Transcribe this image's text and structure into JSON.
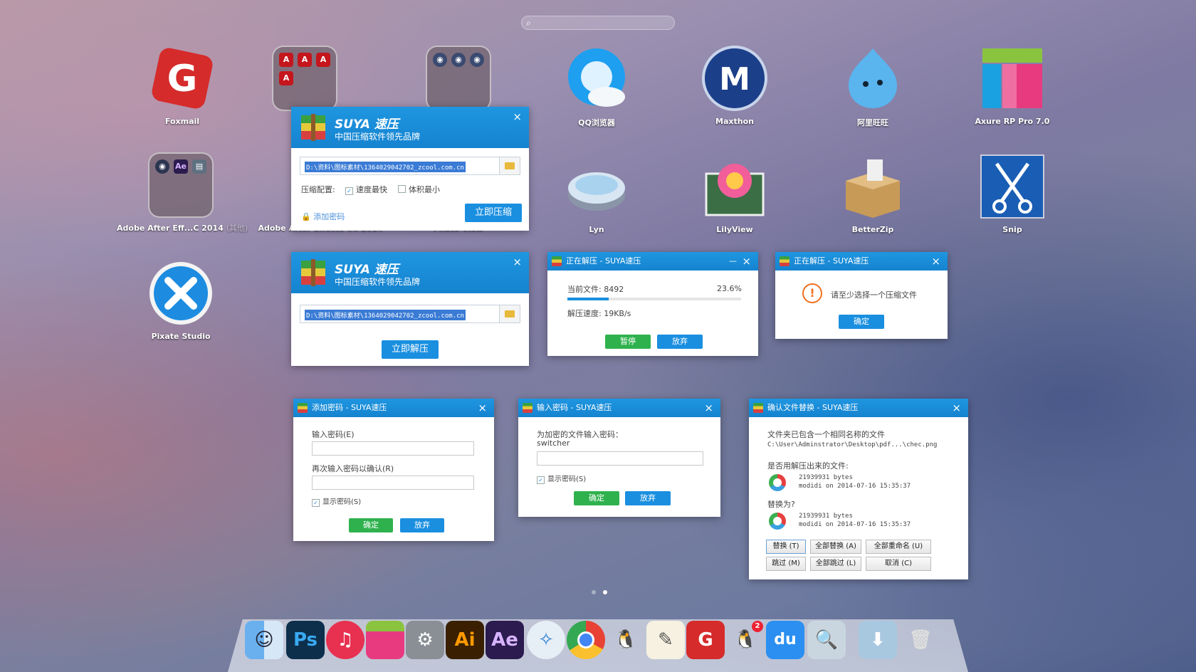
{
  "search": {
    "glyph": "⌕"
  },
  "apps": {
    "foxmail": "Foxmail",
    "folder_adobe": "",
    "folder_photo": "",
    "qq": "QQ浏览器",
    "maxthon": "Maxthon",
    "aliww": "阿里旺旺",
    "axure": "Axure RP Pro 7.0",
    "after_eff": "Adobe After Eff...C 2014",
    "after_eff_suffix": "(其他)",
    "after_effects_cc": "Adobe After Effects CC 2014",
    "photo_view": "Photo View",
    "lyn": "Lyn",
    "lilyview": "LilyView",
    "betterzip": "BetterZip",
    "snip": "Snip",
    "pixate": "Pixate Studio"
  },
  "win_compress": {
    "brand": "SUYA 速压",
    "slogan": "中国压缩软件领先品牌",
    "path": "D:\\资料\\图标素材\\1364029042702_zcool.com.cn",
    "config_label": "压缩配置:",
    "opt_fast": "速度最快",
    "opt_small": "体积最小",
    "add_password": "添加密码",
    "button": "立即压缩"
  },
  "win_extract": {
    "brand": "SUYA 速压",
    "slogan": "中国压缩软件领先品牌",
    "path": "D:\\资料\\图标素材\\1364029042702_zcool.com.cn",
    "button": "立即解压"
  },
  "win_progress": {
    "title": "正在解压 - SUYA速压",
    "current_file": "当前文件: 8492",
    "percent": "23.6%",
    "progress": 0.236,
    "speed": "解压速度: 19KB/s",
    "pause": "暂停",
    "cancel": "放弃"
  },
  "win_alert": {
    "title": "正在解压 - SUYA速压",
    "message": "请至少选择一个压缩文件",
    "ok": "确定"
  },
  "win_addpwd": {
    "title": "添加密码 - SUYA速压",
    "label_enter": "输入密码(E)",
    "label_confirm": "再次输入密码以确认(R)",
    "show": "显示密码(S)",
    "ok": "确定",
    "cancel": "放弃"
  },
  "win_enterpwd": {
    "title": "输入密码 - SUYA速压",
    "prompt": "为加密的文件输入密码：",
    "filename": "switcher",
    "show": "显示密码(S)",
    "ok": "确定",
    "cancel": "放弃"
  },
  "win_replace": {
    "title": "确认文件替换 - SUYA速压",
    "line1": "文件夹已包含一个相同名称的文件",
    "path": "C:\\User\\Adminstrator\\Desktop\\pdf...\\chec.png",
    "question1": "是否用解压出来的文件:",
    "size1": "21939931 bytes",
    "mod1": "modidi on 2014-07-16 15:35:37",
    "question2": "替换为?",
    "size2": "21939931 bytes",
    "mod2": "modidi on 2014-07-16 15:35:37",
    "replace": "替换 (T)",
    "replace_all": "全部替换 (A)",
    "rename_all": "全部重命名 (U)",
    "skip": "跳过 (M)",
    "skip_all": "全部跳过 (L)",
    "cancel": "取消 (C)"
  },
  "dock": {
    "ps": "Ps",
    "ai": "Ai",
    "ae": "Ae",
    "du": "du",
    "qq_badge": "2"
  },
  "colors": {
    "accent": "#1a8fe0",
    "green": "#2fb24e",
    "header": "#1583d0"
  }
}
